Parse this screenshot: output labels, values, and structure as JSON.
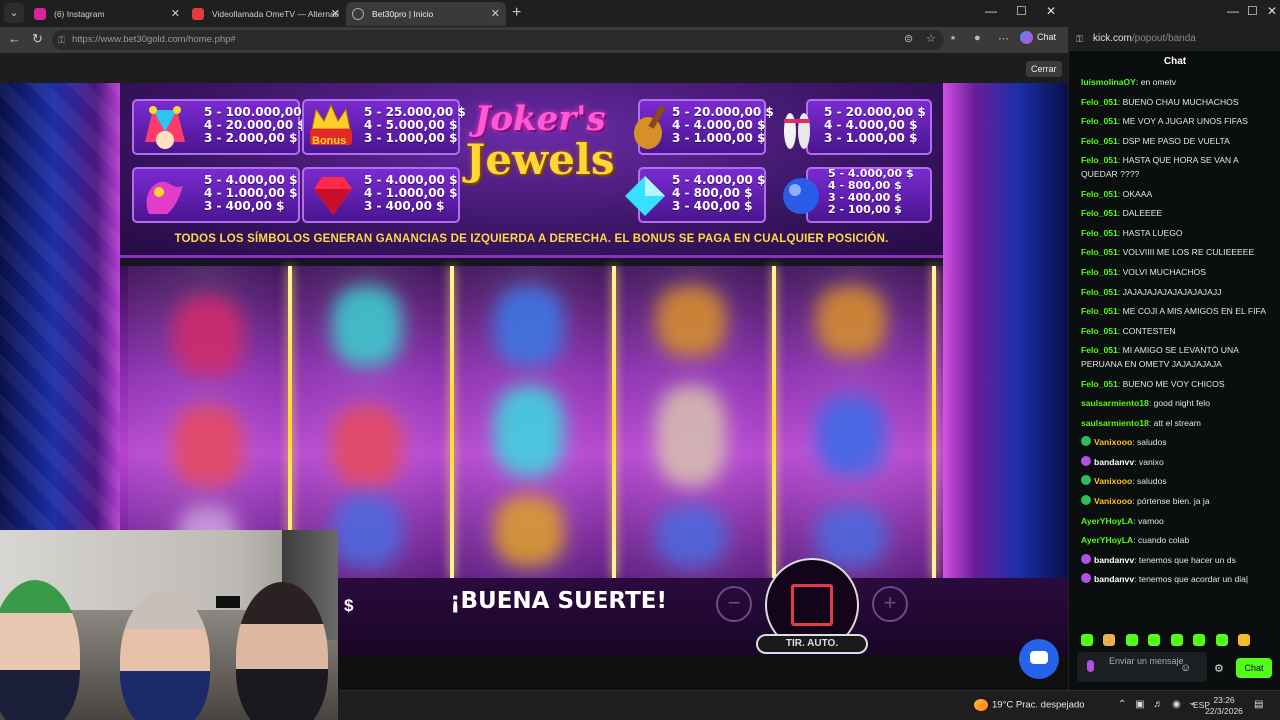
{
  "browser": {
    "tabs": [
      {
        "label": "(6) Instagram",
        "color": "#d6249f"
      },
      {
        "label": "Videollamada OmeTV — Alternati",
        "color": "#e23c3c"
      },
      {
        "label": "Bet30pro | Inicio",
        "color": "#888888"
      }
    ],
    "url": "https://www.bet30gold.com/home.php#",
    "chat_label": "Chat",
    "close_label": "Cerrar"
  },
  "game": {
    "paytable": {
      "left_items": [
        {
          "symbol": "jester-hat-icon",
          "lines": [
            "5 - 100.000,00 $",
            "4 - 20.000,00 $",
            "3 - 2.000,00 $"
          ]
        },
        {
          "symbol": "bonus-crown-icon",
          "lines": [
            "5 - 25.000,00 $",
            "4 - 5.000,00 $",
            "3 - 1.000,00 $"
          ]
        },
        {
          "symbol": "jester-glove-icon",
          "lines": [
            "5 - 4.000,00 $",
            "4 - 1.000,00 $",
            "3 - 400,00 $"
          ]
        },
        {
          "symbol": "red-gem-icon",
          "lines": [
            "5 - 4.000,00 $",
            "4 - 1.000,00 $",
            "3 - 400,00 $"
          ]
        }
      ],
      "right_items": [
        {
          "symbol": "lute-icon",
          "lines": [
            "5 - 20.000,00 $",
            "4 - 4.000,00 $",
            "3 - 1.000,00 $"
          ]
        },
        {
          "symbol": "bowling-pins-icon",
          "lines": [
            "5 - 20.000,00 $",
            "4 - 4.000,00 $",
            "3 - 1.000,00 $"
          ]
        },
        {
          "symbol": "cyan-gem-icon",
          "lines": [
            "5 - 4.000,00 $",
            "4 - 800,00 $",
            "3 - 400,00 $"
          ]
        },
        {
          "symbol": "blue-gem-icon",
          "lines": [
            "5 - 4.000,00 $",
            "4 - 800,00 $",
            "3 - 400,00 $",
            "2 - 100,00 $"
          ]
        }
      ],
      "bonus_text": "Bonus",
      "logo_line1": "Joker's",
      "logo_line2": "Jewels",
      "rule": "TODOS LOS SÍMBOLOS GENERAN GANANCIAS DE IZQUIERDA A DERECHA. EL BONUS SE PAGA EN CUALQUIER POSICIÓN."
    },
    "currency": "$",
    "status": "¡BUENA SUERTE!",
    "minus": "−",
    "plus": "+",
    "auto_label": "TIR. AUTO."
  },
  "chat": {
    "host": "kick.com",
    "path": "/popout/banda",
    "title": "Chat",
    "messages": [
      {
        "user": "luismolinaOY",
        "text": ": en ometv",
        "color": "#53fc18",
        "badge": ""
      },
      {
        "user": "Felo_051",
        "text": ": BUENO CHAU MUCHACHOS",
        "color": "#53fc18",
        "badge": ""
      },
      {
        "user": "Felo_051",
        "text": ": ME VOY A JUGAR UNOS FIFAS",
        "color": "#53fc18",
        "badge": ""
      },
      {
        "user": "Felo_051",
        "text": ": DSP ME PASO DE VUELTA",
        "color": "#53fc18",
        "badge": ""
      },
      {
        "user": "Felo_051",
        "text": ": HASTA QUE HORA SE VAN A QUEDAR ????",
        "color": "#53fc18",
        "badge": ""
      },
      {
        "user": "Felo_051",
        "text": ": OKAAA",
        "color": "#53fc18",
        "badge": ""
      },
      {
        "user": "Felo_051",
        "text": ": DALEEEE",
        "color": "#53fc18",
        "badge": ""
      },
      {
        "user": "Felo_051",
        "text": ": HASTA LUEGO",
        "color": "#53fc18",
        "badge": ""
      },
      {
        "user": "Felo_051",
        "text": ": VOLVIIII ME LOS RE CULIEEEEE",
        "color": "#53fc18",
        "badge": ""
      },
      {
        "user": "Felo_051",
        "text": ": VOLVI MUCHACHOS",
        "color": "#53fc18",
        "badge": ""
      },
      {
        "user": "Felo_051",
        "text": ": JAJAJAJAJAJAJAJAJAJJ",
        "color": "#53fc18",
        "badge": ""
      },
      {
        "user": "Felo_051",
        "text": ": ME COJI A MIS AMIGOS EN EL FIFA",
        "color": "#53fc18",
        "badge": ""
      },
      {
        "user": "Felo_051",
        "text": ": CONTESTEN",
        "color": "#53fc18",
        "badge": ""
      },
      {
        "user": "Felo_051",
        "text": ": MI AMIGO SE LEVANTÓ UNA PERUANA EN OMETV JAJAJAJAJA",
        "color": "#53fc18",
        "badge": ""
      },
      {
        "user": "Felo_051",
        "text": ": BUENO ME VOY CHICOS",
        "color": "#53fc18",
        "badge": ""
      },
      {
        "user": "saulsarmiento18",
        "text": ": good night felo",
        "color": "#53fc18",
        "badge": ""
      },
      {
        "user": "saulsarmiento18",
        "text": ": att el stream",
        "color": "#53fc18",
        "badge": ""
      },
      {
        "user": "Vanixooo",
        "text": ": saludos",
        "color": "#ffc21a",
        "badge": "#2ebd59"
      },
      {
        "user": "bandanvv",
        "text": ": vanixo",
        "color": "#ffffff",
        "badge": "#b24fe8"
      },
      {
        "user": "Vanixooo",
        "text": ": saludos",
        "color": "#ffc21a",
        "badge": "#2ebd59"
      },
      {
        "user": "Vanixooo",
        "text": ": pórtense bien. ja ja",
        "color": "#ffc21a",
        "badge": "#2ebd59"
      },
      {
        "user": "AyerYHoyLA",
        "text": ": vamoo",
        "color": "#53fc18",
        "badge": ""
      },
      {
        "user": "AyerYHoyLA",
        "text": ": cuando colab",
        "color": "#53fc18",
        "badge": ""
      },
      {
        "user": "bandanvv",
        "text": ": tenemos que hacer un ds",
        "color": "#ffffff",
        "badge": "#b24fe8"
      },
      {
        "user": "bandanvv",
        "text": ": tenemos que acordar un dia|",
        "color": "#ffffff",
        "badge": "#b24fe8"
      }
    ],
    "input_placeholder": "Enviar un mensaje",
    "send_label": "Chat",
    "accent": "#53fc18"
  },
  "taskbar": {
    "weather": "19°C  Prac. despejado",
    "lang": "ESP",
    "time": "23:26",
    "date": "22/3/2026"
  }
}
